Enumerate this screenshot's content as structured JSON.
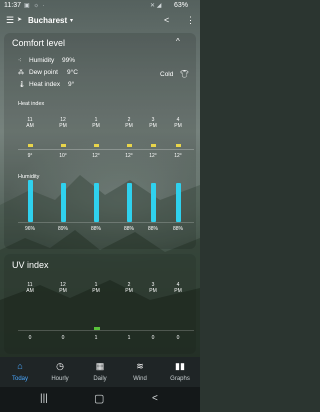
{
  "status_bar": {
    "time": "11:37",
    "battery": "63%"
  },
  "header": {
    "city": "Bucharest"
  },
  "comfort": {
    "title": "Comfort level",
    "humidity": "Humidity",
    "humidity_value": "99%",
    "dew_point": "Dew point",
    "dew_point_value": "9°C",
    "heat_index": "Heat index",
    "heat_index_value": "9°",
    "feel": "Cold"
  },
  "heat_index_chart": {
    "label": "Heat index",
    "hours": [
      {
        "h": "11",
        "p": "AM",
        "v": "9°"
      },
      {
        "h": "12",
        "p": "PM",
        "v": "10°"
      },
      {
        "h": "1",
        "p": "PM",
        "v": "12°"
      },
      {
        "h": "2",
        "p": "PM",
        "v": "12°"
      },
      {
        "h": "3",
        "p": "PM",
        "v": "12°"
      },
      {
        "h": "4",
        "p": "PM",
        "v": "12°"
      }
    ]
  },
  "humidity_chart": {
    "label": "Humidity",
    "values": [
      "96%",
      "89%",
      "88%",
      "88%",
      "88%",
      "88%"
    ],
    "levels": [
      96,
      89,
      88,
      88,
      88,
      88
    ]
  },
  "uv": {
    "title": "UV index",
    "hours": [
      {
        "h": "11",
        "p": "AM",
        "v": "0"
      },
      {
        "h": "12",
        "p": "PM",
        "v": "0"
      },
      {
        "h": "1",
        "p": "PM",
        "v": "1"
      },
      {
        "h": "2",
        "p": "PM",
        "v": "1"
      },
      {
        "h": "3",
        "p": "PM",
        "v": "0"
      },
      {
        "h": "4",
        "p": "PM",
        "v": "0"
      }
    ]
  },
  "nav": {
    "tabs": [
      {
        "label": "Today",
        "icon": "home-icon"
      },
      {
        "label": "Hourly",
        "icon": "clock-icon"
      },
      {
        "label": "Daily",
        "icon": "calendar-icon"
      },
      {
        "label": "Wind",
        "icon": "wind-icon"
      },
      {
        "label": "Graphs",
        "icon": "bar-chart-icon"
      }
    ]
  },
  "colors": {
    "accent": "#4aa8ff",
    "humidity_bar": "#2fd1ee",
    "uv_low": "#59c23a",
    "heat_dot": "#e9d54a"
  }
}
